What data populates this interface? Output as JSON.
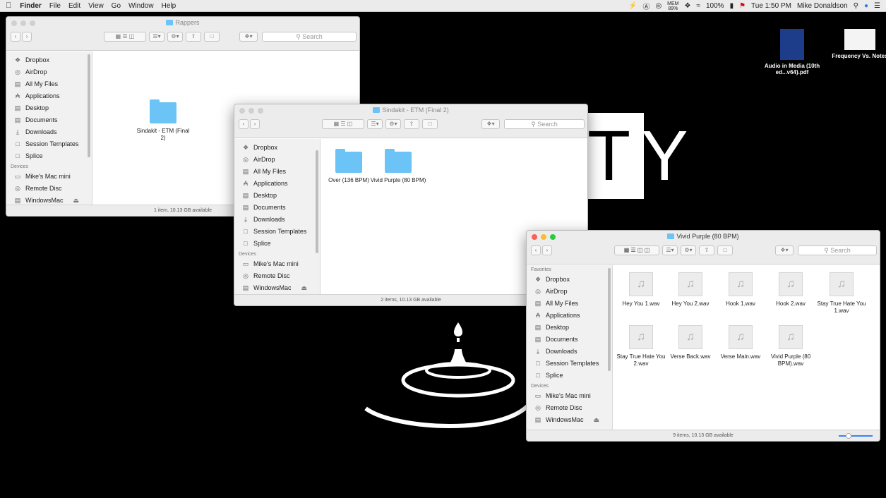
{
  "menubar": {
    "app": "Finder",
    "items": [
      "File",
      "Edit",
      "View",
      "Go",
      "Window",
      "Help"
    ],
    "mem_top": "MEM",
    "mem_value": "89%",
    "battery": "100%",
    "clock": "Tue 1:50 PM",
    "user": "Mike Donaldson"
  },
  "desktop": {
    "icons": [
      {
        "label": "Audio in Media (10th ed...v64).pdf"
      },
      {
        "label": "Frequency Vs. Notes"
      }
    ],
    "wallpaper_text": "TY"
  },
  "sidebar_items": [
    "Dropbox",
    "AirDrop",
    "All My Files",
    "Applications",
    "Desktop",
    "Documents",
    "Downloads",
    "Session Templates",
    "Splice"
  ],
  "devices_label": "Devices",
  "favorites_label": "Favorites",
  "device_items": [
    "Mike's Mac mini",
    "Remote Disc",
    "WindowsMac"
  ],
  "search_placeholder": "Search",
  "win1": {
    "title": "Rappers",
    "items": [
      "Sindakit - ETM (Final 2)"
    ],
    "status": "1 item, 10.13 GB available"
  },
  "win2": {
    "title": "Sindakit - ETM (Final 2)",
    "items": [
      "Over (136 BPM)",
      "Vivid Purple (80 BPM)"
    ],
    "status": "2 items, 10.13 GB available"
  },
  "win3": {
    "title": "Vivid Purple (80 BPM)",
    "items": [
      "Hey You 1.wav",
      "Hey You 2.wav",
      "Hook 1.wav",
      "Hook 2.wav",
      "Stay True Hate You 1.wav",
      "Stay True Hate You 2.wav",
      "Verse Back.wav",
      "Verse Main.wav",
      "Vivid Purple (80 BPM).wav"
    ],
    "status": "9 items, 10.13 GB available",
    "icon_size": 0.2
  }
}
